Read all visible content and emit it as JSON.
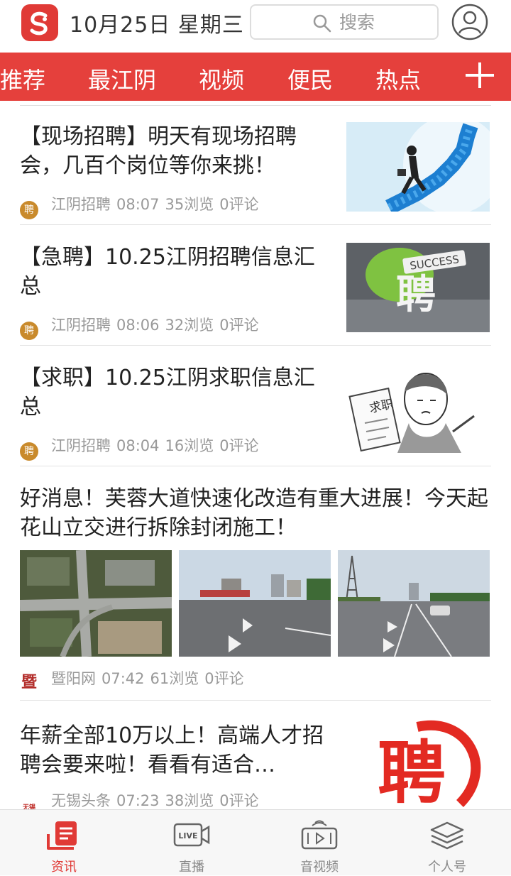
{
  "header": {
    "date": "10月25日 星期三",
    "search_placeholder": "搜索"
  },
  "tabs": [
    {
      "label": "推荐"
    },
    {
      "label": "最江阴"
    },
    {
      "label": "视频"
    },
    {
      "label": "便民",
      "active": true
    },
    {
      "label": "热点"
    }
  ],
  "articles": [
    {
      "title": "【现场招聘】明天有现场招聘会，几百个岗位等你来挑！",
      "source": "江阴招聘",
      "time": "08:07",
      "views": "35浏览",
      "comments": "0评论",
      "thumb": "businessman-stairs"
    },
    {
      "title": "【急聘】10.25江阴招聘信息汇总",
      "source": "江阴招聘",
      "time": "08:06",
      "views": "32浏览",
      "comments": "0评论",
      "thumb": "success-sign-pin",
      "thumb_text": "聘",
      "thumb_sign": "SUCCESS"
    },
    {
      "title": "【求职】10.25江阴求职信息汇总",
      "source": "江阴招聘",
      "time": "08:04",
      "views": "16浏览",
      "comments": "0评论",
      "thumb": "job-seeker-cartoon",
      "thumb_text": "求职"
    },
    {
      "title": "好消息！芙蓉大道快速化改造有重大进展！今天起花山立交进行拆除封闭施工！",
      "source": "暨阳网",
      "time": "07:42",
      "views": "61浏览",
      "comments": "0评论",
      "thumbs": [
        "aerial-interchange",
        "road-construction",
        "highway-view"
      ]
    },
    {
      "title": "年薪全部10万以上！高端人才招聘会要来啦！看看有适合…",
      "source": "无锡头条",
      "time": "07:23",
      "views": "38浏览",
      "comments": "0评论",
      "thumb": "recruit-calligraphy",
      "thumb_text": "聘"
    }
  ],
  "source_icons": {
    "江阴招聘": "聘",
    "暨阳网": "暨",
    "无锡头条": "无锡"
  },
  "bottom_nav": [
    {
      "label": "资讯",
      "icon": "news-icon",
      "active": true
    },
    {
      "label": "直播",
      "icon": "live-icon"
    },
    {
      "label": "音视频",
      "icon": "media-icon"
    },
    {
      "label": "个人号",
      "icon": "layers-icon"
    }
  ],
  "colors": {
    "brand": "#e5403c",
    "meta": "#999999"
  }
}
